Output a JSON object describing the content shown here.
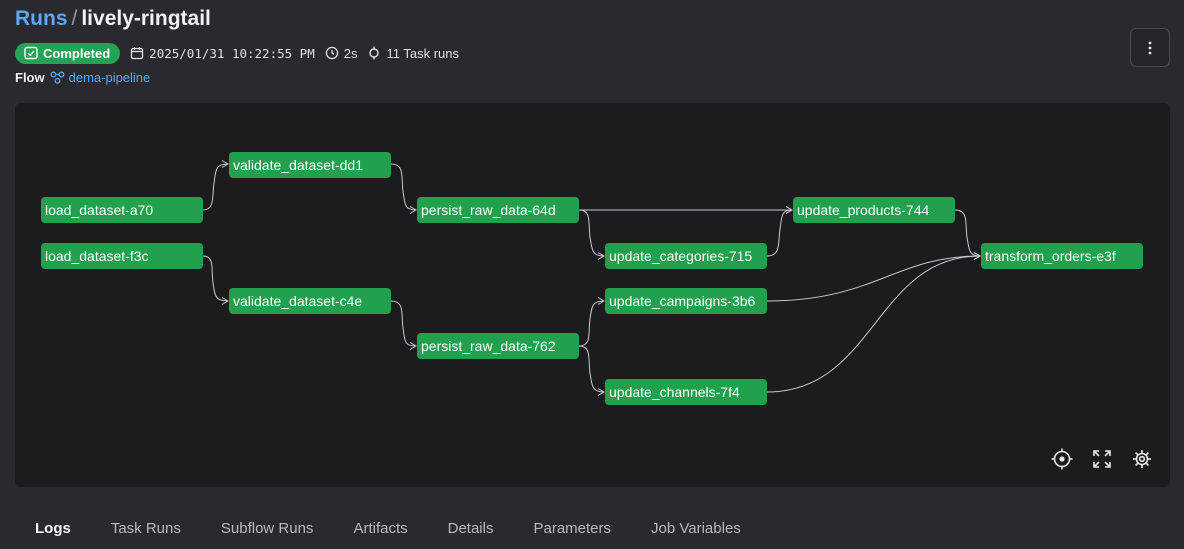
{
  "header": {
    "breadcrumb_root": "Runs",
    "separator": "/",
    "run_name": "lively-ringtail"
  },
  "meta": {
    "status": "Completed",
    "timestamp": "2025/01/31 10:22:55 PM",
    "duration": "2s",
    "task_runs": "11 Task runs"
  },
  "flow": {
    "label": "Flow",
    "name": "dema-pipeline"
  },
  "graph": {
    "nodes": {
      "load_a70": "load_dataset-a70",
      "load_f3c": "load_dataset-f3c",
      "validate_dd1": "validate_dataset-dd1",
      "validate_c4e": "validate_dataset-c4e",
      "persist_64d": "persist_raw_data-64d",
      "persist_762": "persist_raw_data-762",
      "update_categories": "update_categories-715",
      "update_campaigns": "update_campaigns-3b6",
      "update_channels": "update_channels-7f4",
      "update_products": "update_products-744",
      "transform_orders": "transform_orders-e3f"
    }
  },
  "tabs": [
    "Logs",
    "Task Runs",
    "Subflow Runs",
    "Artifacts",
    "Details",
    "Parameters",
    "Job Variables"
  ],
  "colors": {
    "accent": "#5aa7ff",
    "status_green": "#23a454",
    "node_green": "#21a04e",
    "canvas_bg": "#1c1c1e",
    "page_bg": "#2a2a2e"
  }
}
